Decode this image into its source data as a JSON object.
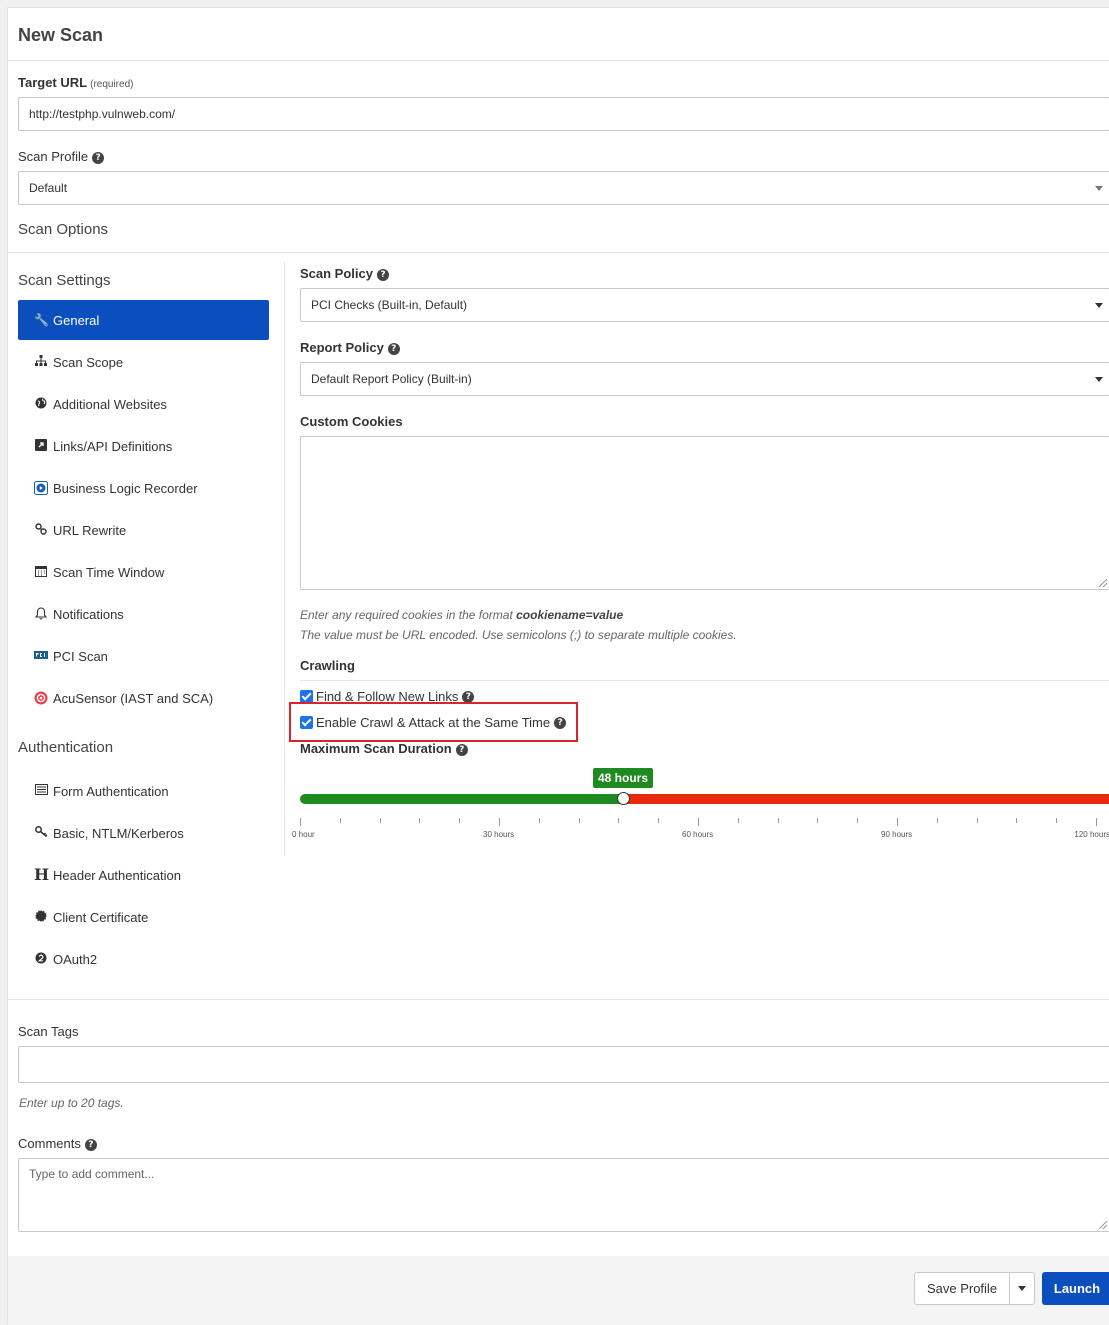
{
  "page": {
    "title": "New Scan"
  },
  "target": {
    "label": "Target URL",
    "required": "(required)",
    "value": "http://testphp.vulnweb.com/"
  },
  "profile": {
    "label": "Scan Profile",
    "value": "Default"
  },
  "scan_options": {
    "title": "Scan Options"
  },
  "scan_settings": {
    "title": "Scan Settings",
    "items": [
      {
        "label": "General",
        "icon": "wrench-icon",
        "active": true
      },
      {
        "label": "Scan Scope",
        "icon": "sitemap-icon"
      },
      {
        "label": "Additional Websites",
        "icon": "globe-icon"
      },
      {
        "label": "Links/API Definitions",
        "icon": "external-link-icon"
      },
      {
        "label": "Business Logic Recorder",
        "icon": "recorder-icon"
      },
      {
        "label": "URL Rewrite",
        "icon": "link-icon"
      },
      {
        "label": "Scan Time Window",
        "icon": "calendar-icon"
      },
      {
        "label": "Notifications",
        "icon": "bell-icon"
      },
      {
        "label": "PCI Scan",
        "icon": "pci-icon"
      },
      {
        "label": "AcuSensor (IAST and SCA)",
        "icon": "acusensor-icon"
      }
    ]
  },
  "authentication": {
    "title": "Authentication",
    "items": [
      {
        "label": "Form Authentication",
        "icon": "form-icon"
      },
      {
        "label": "Basic, NTLM/Kerberos",
        "icon": "key-icon"
      },
      {
        "label": "Header Authentication",
        "icon": "header-icon"
      },
      {
        "label": "Client Certificate",
        "icon": "certificate-icon"
      },
      {
        "label": "OAuth2",
        "icon": "oauth-icon"
      }
    ]
  },
  "general": {
    "scan_policy": {
      "label": "Scan Policy",
      "value": "PCI Checks (Built-in, Default)"
    },
    "report_policy": {
      "label": "Report Policy",
      "value": "Default Report Policy (Built-in)"
    },
    "custom_cookies": {
      "label": "Custom Cookies",
      "hint1_prefix": "Enter any required cookies in the format ",
      "hint1_bold": "cookiename=value",
      "hint2": "The value must be URL encoded. Use semicolons (;) to separate multiple cookies."
    },
    "crawling": {
      "title": "Crawling",
      "find_follow": "Find & Follow New Links",
      "crawl_attack": "Enable Crawl & Attack at the Same Time"
    },
    "duration": {
      "label": "Maximum Scan Duration",
      "value_label": "48 hours",
      "value_hours": 48,
      "max_hours": 120,
      "ticks": [
        "0 hour",
        "30 hours",
        "60 hours",
        "90 hours",
        "120 hours"
      ]
    }
  },
  "tags": {
    "label": "Scan Tags",
    "hint": "Enter up to 20 tags."
  },
  "comments": {
    "label": "Comments",
    "placeholder": "Type to add comment..."
  },
  "footer": {
    "save_profile": "Save Profile",
    "launch": "Launch"
  },
  "colors": {
    "primary": "#0b4fbf",
    "green": "#1f8a1f",
    "red": "#e8290b",
    "highlight": "#d9232d"
  }
}
